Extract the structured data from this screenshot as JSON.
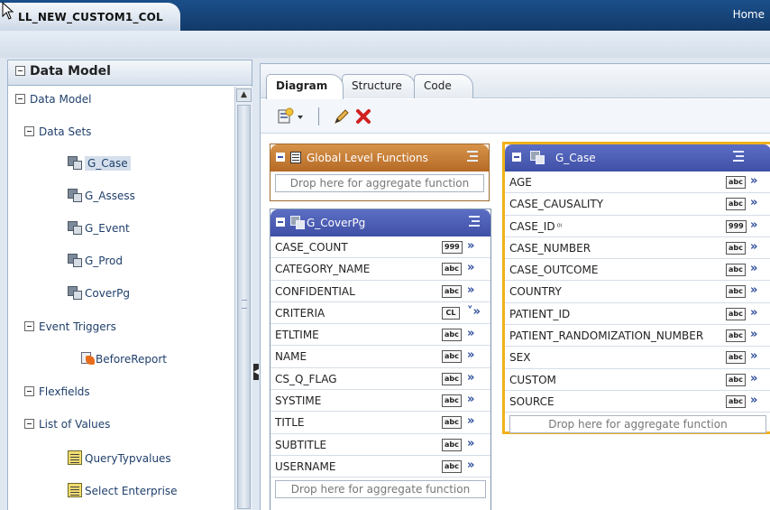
{
  "window": {
    "doc_tab_title": "LL_NEW_CUSTOM1_COL",
    "home_link": "Home"
  },
  "left_panel": {
    "title": "Data Model",
    "tree": {
      "root": "Data Model",
      "data_sets_label": "Data Sets",
      "data_sets": [
        "G_Case",
        "G_Assess",
        "G_Event",
        "G_Prod",
        "CoverPg"
      ],
      "selected_data_set": "G_Case",
      "event_triggers_label": "Event Triggers",
      "event_triggers": [
        "BeforeReport"
      ],
      "flexfields_label": "Flexfields",
      "lov_label": "List of Values",
      "lovs": [
        "QueryTypvalues",
        "Select Enterprise"
      ]
    }
  },
  "editor": {
    "tabs": [
      "Diagram",
      "Structure",
      "Code"
    ],
    "active_tab": "Diagram",
    "toolbar_icons": [
      "new-data-set-icon",
      "dropdown-arrow-icon",
      "edit-pencil-icon",
      "delete-x-icon"
    ]
  },
  "global_level_functions": {
    "title": "Global Level Functions",
    "drop_text": "Drop here for aggregate function"
  },
  "g_coverpg": {
    "title": "G_CoverPg",
    "elements": [
      {
        "name": "CASE_COUNT",
        "type": "999"
      },
      {
        "name": "CATEGORY_NAME",
        "type": "abc"
      },
      {
        "name": "CONFIDENTIAL",
        "type": "abc"
      },
      {
        "name": "CRITERIA",
        "type": "CL"
      },
      {
        "name": "ETLTIME",
        "type": "abc"
      },
      {
        "name": "NAME",
        "type": "abc"
      },
      {
        "name": "CS_Q_FLAG",
        "type": "abc"
      },
      {
        "name": "SYSTIME",
        "type": "abc"
      },
      {
        "name": "TITLE",
        "type": "abc"
      },
      {
        "name": "SUBTITLE",
        "type": "abc"
      },
      {
        "name": "USERNAME",
        "type": "abc"
      }
    ],
    "drop_text": "Drop here for aggregate function"
  },
  "g_case": {
    "title": "G_Case",
    "elements": [
      {
        "name": "AGE",
        "type": "abc"
      },
      {
        "name": "CASE_CAUSALITY",
        "type": "abc"
      },
      {
        "name": "CASE_ID",
        "type": "999",
        "key": true
      },
      {
        "name": "CASE_NUMBER",
        "type": "abc"
      },
      {
        "name": "CASE_OUTCOME",
        "type": "abc"
      },
      {
        "name": "COUNTRY",
        "type": "abc"
      },
      {
        "name": "PATIENT_ID",
        "type": "abc"
      },
      {
        "name": "PATIENT_RANDOMIZATION_NUMBER",
        "type": "abc"
      },
      {
        "name": "SEX",
        "type": "abc"
      },
      {
        "name": "CUSTOM",
        "type": "abc"
      },
      {
        "name": "SOURCE",
        "type": "abc"
      }
    ],
    "drop_text": "Drop here for aggregate function"
  },
  "colors": {
    "top_bar": "#1b4f8a",
    "group_header": "#3f4fa6",
    "global_header": "#b56a26",
    "selection_border": "#f0b21b"
  }
}
